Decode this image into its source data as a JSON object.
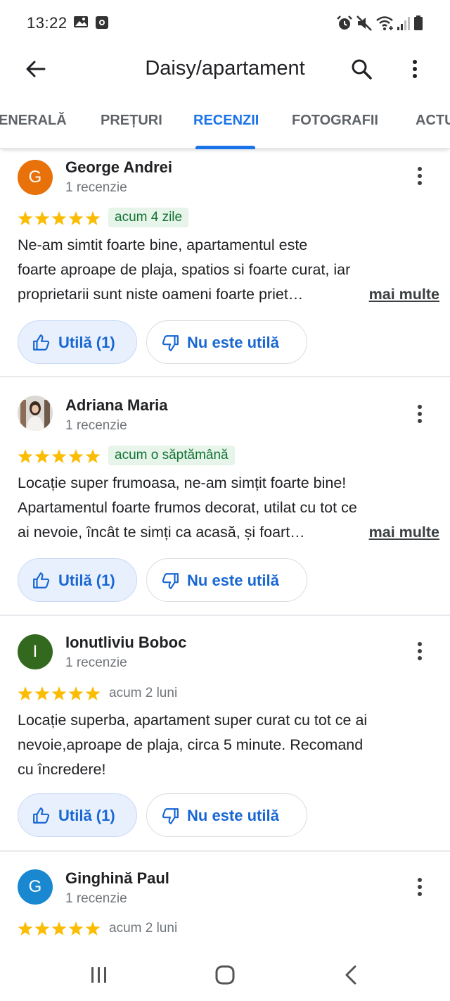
{
  "status_bar": {
    "time": "13:22",
    "left_icons": [
      "gallery-icon",
      "screenshot-icon"
    ],
    "right_icons": [
      "alarm-icon",
      "mute-icon",
      "wifi-icon",
      "signal-icon",
      "battery-icon"
    ]
  },
  "app_bar": {
    "title": "Daisy/apartament",
    "icons": [
      "back-arrow-icon",
      "search-icon",
      "more-vert-icon"
    ]
  },
  "tabs": [
    {
      "label": "ENERALĂ",
      "active": false
    },
    {
      "label": "PREȚURI",
      "active": false
    },
    {
      "label": "RECENZII",
      "active": true
    },
    {
      "label": "FOTOGRAFII",
      "active": false
    },
    {
      "label": "ACTU",
      "active": false
    }
  ],
  "reviews": [
    {
      "avatar_letter": "G",
      "avatar_color": "#e8710a",
      "name": "George Andrei",
      "review_count": "1 recenzie",
      "rating": 5,
      "date": "acum 4 zile",
      "date_highlighted": true,
      "lines": [
        "Ne-am simtit foarte bine, apartamentul este",
        "foarte aproape de plaja, spatios si foarte curat, iar",
        "proprietarii sunt niste oameni foarte priet…"
      ],
      "more_label": "mai multe",
      "useful_label": "Utilă (1)",
      "not_useful_label": "Nu este utilă"
    },
    {
      "avatar_letter": "",
      "avatar_color": "#d9d4cf",
      "name": "Adriana Maria",
      "review_count": "1 recenzie",
      "rating": 5,
      "date": "acum o săptămână",
      "date_highlighted": true,
      "lines": [
        "Locație super frumoasa, ne-am simțit foarte bine!",
        "Apartamentul foarte frumos decorat, utilat cu tot ce",
        "ai nevoie, încât te simți ca acasă, și foart…"
      ],
      "more_label": "mai multe",
      "useful_label": "Utilă (1)",
      "not_useful_label": "Nu este utilă"
    },
    {
      "avatar_letter": "I",
      "avatar_color": "#33691e",
      "name": "Ionutliviu Boboc",
      "review_count": "1 recenzie",
      "rating": 5,
      "date": "acum 2 luni",
      "date_highlighted": false,
      "lines": [
        "Locație superba, apartament super curat cu tot ce ai",
        "nevoie,aproape de plaja, circa 5 minute. Recomand",
        "cu încredere!"
      ],
      "more_label": "",
      "useful_label": "Utilă (1)",
      "not_useful_label": "Nu este utilă"
    },
    {
      "avatar_letter": "G",
      "avatar_color": "#1a88d1",
      "name": "Ginghină Paul",
      "review_count": "1 recenzie",
      "rating": 5,
      "date": "acum 2 luni",
      "date_highlighted": false,
      "lines": [],
      "more_label": "",
      "useful_label": "",
      "not_useful_label": ""
    }
  ],
  "nav_bar": {
    "icons": [
      "recents-icon",
      "home-icon",
      "back-icon"
    ]
  }
}
